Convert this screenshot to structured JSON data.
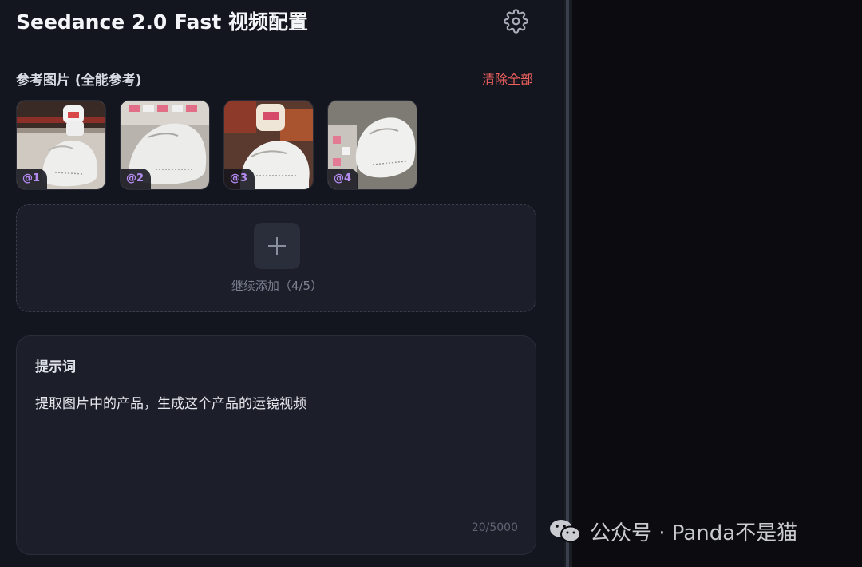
{
  "header": {
    "title": "Seedance 2.0 Fast 视频配置",
    "settings_icon": "gear-icon"
  },
  "reference": {
    "label": "参考图片 (全能参考)",
    "clear_all": "清除全部",
    "images": [
      {
        "tag": "@1"
      },
      {
        "tag": "@2"
      },
      {
        "tag": "@3"
      },
      {
        "tag": "@4"
      }
    ],
    "add": {
      "icon": "plus-icon",
      "label": "继续添加（4/5）"
    }
  },
  "prompt": {
    "label": "提示词",
    "value": "提取图片中的产品，生成这个产品的运镜视频",
    "count": "20/5000"
  },
  "watermark": {
    "text": "公众号 · Panda不是猫",
    "icon": "wechat-icon"
  },
  "colors": {
    "background": "#14161f",
    "accent_red": "#f0605e",
    "badge_purple": "#b48cf2"
  }
}
